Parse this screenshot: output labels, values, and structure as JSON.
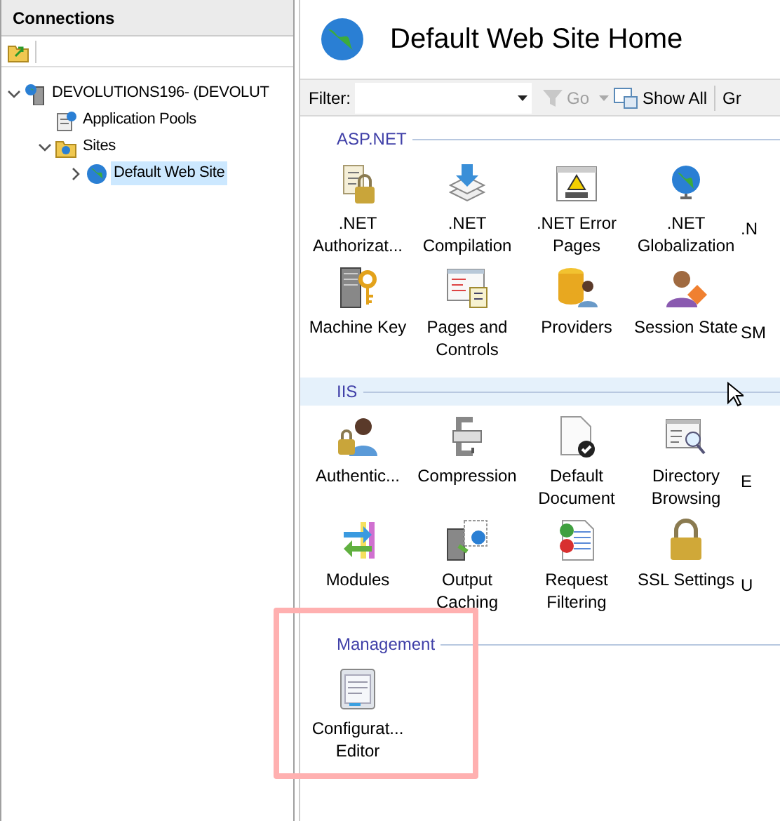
{
  "connections": {
    "title": "Connections",
    "tree": [
      {
        "label": "DEVOLUTIONS196- (DEVOLUT",
        "expanded": true,
        "selected": false,
        "children": [
          {
            "label": "Application Pools",
            "selected": false
          },
          {
            "label": "Sites",
            "expanded": true,
            "selected": false,
            "children": [
              {
                "label": "Default Web Site",
                "expanded": false,
                "selected": true
              }
            ]
          }
        ]
      }
    ]
  },
  "page": {
    "title": "Default Web Site Home",
    "toolbar": {
      "filter_label": "Filter:",
      "go": {
        "label": "Go",
        "disabled": true
      },
      "show_all": "Show All",
      "column_4": "Gr"
    },
    "sections": [
      {
        "title": "ASP.NET",
        "selected": false,
        "annotated": false,
        "rows": [
          [
            {
              "kind": "feature",
              "label": ".NET Authorizat..."
            },
            {
              "kind": "feature",
              "label": ".NET Compilation"
            },
            {
              "kind": "feature",
              "label": ".NET Error Pages"
            },
            {
              "kind": "feature",
              "label": ".NET Globalization"
            },
            {
              "kind": "partial",
              "label": ".N"
            }
          ],
          [
            {
              "kind": "feature",
              "label": "Machine Key"
            },
            {
              "kind": "feature",
              "label": "Pages and Controls"
            },
            {
              "kind": "feature",
              "label": "Providers"
            },
            {
              "kind": "feature",
              "label": "Session State"
            },
            {
              "kind": "partial",
              "label": "SM"
            }
          ]
        ]
      },
      {
        "title": "IIS",
        "selected": true,
        "annotated": false,
        "rows": [
          [
            {
              "kind": "feature",
              "label": "Authentic..."
            },
            {
              "kind": "feature",
              "label": "Compression"
            },
            {
              "kind": "feature",
              "label": "Default Document"
            },
            {
              "kind": "feature",
              "label": "Directory Browsing"
            },
            {
              "kind": "partial",
              "label": "E"
            }
          ],
          [
            {
              "kind": "feature",
              "label": "Modules"
            },
            {
              "kind": "feature",
              "label": "Output Caching"
            },
            {
              "kind": "feature",
              "label": "Request Filtering"
            },
            {
              "kind": "feature",
              "label": "SSL Settings"
            },
            {
              "kind": "partial",
              "label": "U"
            }
          ]
        ]
      },
      {
        "title": "Management",
        "selected": false,
        "annotated": true,
        "rows": [
          [
            {
              "kind": "feature",
              "label": "Configurat... Editor"
            }
          ]
        ]
      }
    ]
  }
}
